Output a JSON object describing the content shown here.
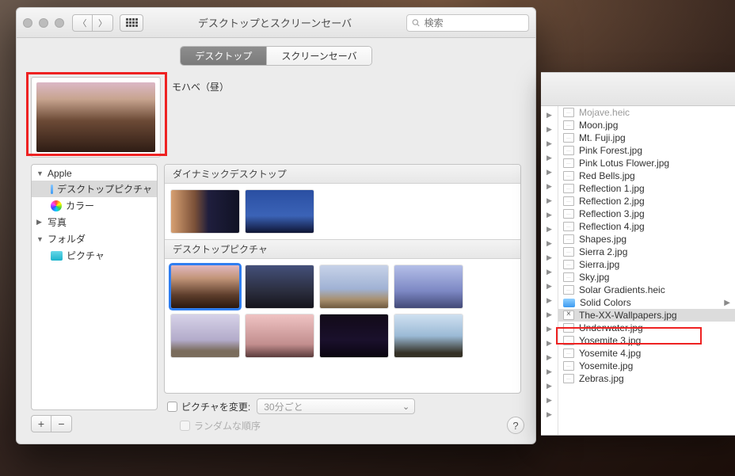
{
  "prefs": {
    "title": "デスクトップとスクリーンセーバ",
    "search_placeholder": "検索",
    "tabs": {
      "desktop": "デスクトップ",
      "screensaver": "スクリーンセーバ"
    },
    "current_name": "モハベ（昼）",
    "sidebar": {
      "apple": "Apple",
      "desktop_pictures": "デスクトップピクチャ",
      "colors": "カラー",
      "photos": "写真",
      "folder": "フォルダ",
      "pictures": "ピクチャ"
    },
    "sections": {
      "dynamic": "ダイナミックデスクトップ",
      "desktop_pictures": "デスクトップピクチャ"
    },
    "options": {
      "change_picture": "ピクチャを変更:",
      "interval": "30分ごと",
      "random": "ランダムな順序"
    }
  },
  "finder": {
    "items": [
      {
        "name": "Mojave.heic",
        "kind": "file",
        "sel": false,
        "clipped": true
      },
      {
        "name": "Moon.jpg",
        "kind": "file"
      },
      {
        "name": "Mt. Fuji.jpg",
        "kind": "file"
      },
      {
        "name": "Pink Forest.jpg",
        "kind": "file"
      },
      {
        "name": "Pink Lotus Flower.jpg",
        "kind": "file"
      },
      {
        "name": "Red Bells.jpg",
        "kind": "file"
      },
      {
        "name": "Reflection 1.jpg",
        "kind": "file"
      },
      {
        "name": "Reflection 2.jpg",
        "kind": "file"
      },
      {
        "name": "Reflection 3.jpg",
        "kind": "file"
      },
      {
        "name": "Reflection 4.jpg",
        "kind": "file"
      },
      {
        "name": "Shapes.jpg",
        "kind": "file"
      },
      {
        "name": "Sierra 2.jpg",
        "kind": "file"
      },
      {
        "name": "Sierra.jpg",
        "kind": "file"
      },
      {
        "name": "Sky.jpg",
        "kind": "file"
      },
      {
        "name": "Solar Gradients.heic",
        "kind": "file"
      },
      {
        "name": "Solid Colors",
        "kind": "folder",
        "arrow": true
      },
      {
        "name": "The-XX-Wallpapers.jpg",
        "kind": "filex",
        "sel": true
      },
      {
        "name": "Underwater.jpg",
        "kind": "file"
      },
      {
        "name": "Yosemite 3.jpg",
        "kind": "file"
      },
      {
        "name": "Yosemite 4.jpg",
        "kind": "file"
      },
      {
        "name": "Yosemite.jpg",
        "kind": "file"
      },
      {
        "name": "Zebras.jpg",
        "kind": "file"
      }
    ]
  }
}
